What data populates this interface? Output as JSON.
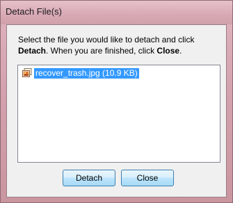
{
  "window": {
    "title": "Detach File(s)"
  },
  "dialog": {
    "instruction_part1": "Select the file you would like to detach and click ",
    "instruction_bold1": "Detach",
    "instruction_part2": ". When you are finished, click ",
    "instruction_bold2": "Close",
    "instruction_part3": ".",
    "files": [
      {
        "name": "recover_trash.jpg (10.9 KB)",
        "icon": "image-file-icon",
        "selected": true
      }
    ],
    "detach_label": "Detach",
    "close_label": "Close"
  },
  "colors": {
    "selection": "#3399ff",
    "frame": "#d3a2ae",
    "button_border": "#3c7fb1"
  }
}
